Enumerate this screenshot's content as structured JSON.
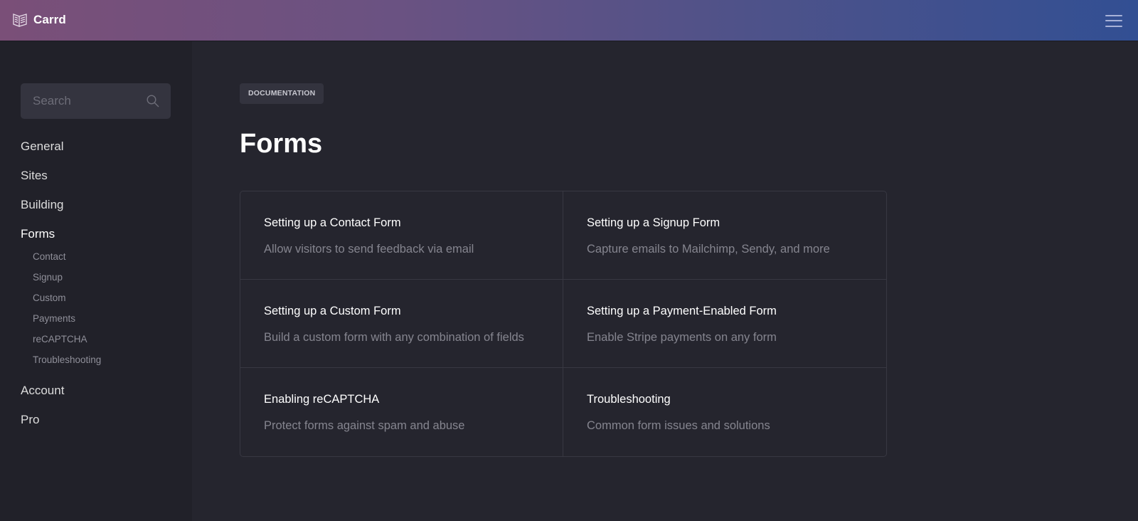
{
  "header": {
    "brand": "Carrd",
    "logo_icon": "carrd-book-icon",
    "menu_icon": "hamburger-menu-icon",
    "gradient": [
      "#7a4f78",
      "#324f93"
    ]
  },
  "sidebar": {
    "search": {
      "placeholder": "Search",
      "value": "",
      "icon": "search-icon"
    },
    "items": [
      {
        "label": "General"
      },
      {
        "label": "Sites"
      },
      {
        "label": "Building"
      },
      {
        "label": "Forms",
        "active": true,
        "children": [
          {
            "label": "Contact"
          },
          {
            "label": "Signup"
          },
          {
            "label": "Custom"
          },
          {
            "label": "Payments"
          },
          {
            "label": "reCAPTCHA"
          },
          {
            "label": "Troubleshooting"
          }
        ]
      },
      {
        "label": "Account"
      },
      {
        "label": "Pro"
      }
    ]
  },
  "main": {
    "badge": "DOCUMENTATION",
    "title": "Forms",
    "cards": [
      {
        "title": "Setting up a Contact Form",
        "description": "Allow visitors to send feedback via email"
      },
      {
        "title": "Setting up a Signup Form",
        "description": "Capture emails to Mailchimp, Sendy, and more"
      },
      {
        "title": "Setting up a Custom Form",
        "description": "Build a custom form with any combination of fields"
      },
      {
        "title": "Setting up a Payment-Enabled Form",
        "description": "Enable Stripe payments on any form"
      },
      {
        "title": "Enabling reCAPTCHA",
        "description": "Protect forms against spam and abuse"
      },
      {
        "title": "Troubleshooting",
        "description": "Common form issues and solutions"
      }
    ]
  }
}
